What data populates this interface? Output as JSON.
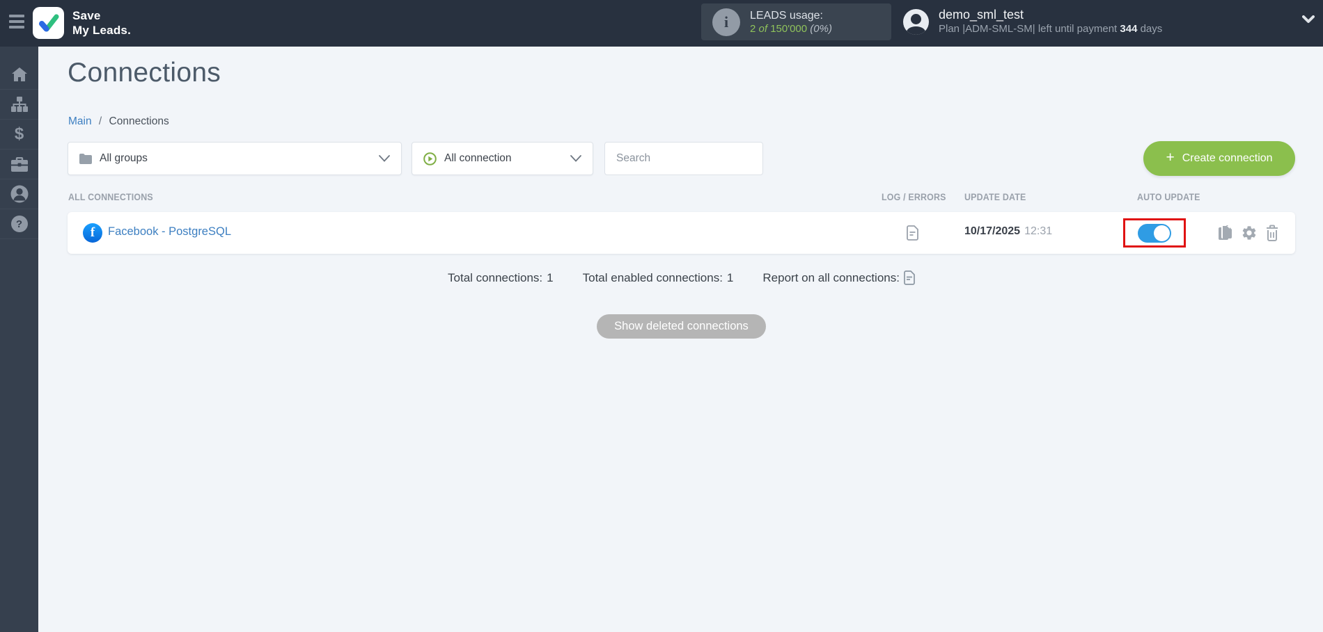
{
  "topbar": {
    "brand_line1": "Save",
    "brand_line2": "My Leads.",
    "leads_usage": {
      "label": "LEADS usage:",
      "used": "2",
      "of_word": "of",
      "total": "150'000",
      "percent": "(0%)"
    },
    "user": {
      "name": "demo_sml_test",
      "plan_prefix": "Plan |ADM-SML-SM| left until payment",
      "days_value": "344",
      "days_suffix": "days"
    }
  },
  "icons": {
    "info_glyph": "i",
    "facebook_glyph": "f",
    "dollar_glyph": "$",
    "question_glyph": "?"
  },
  "sidebar": {
    "items": [
      "home",
      "connections",
      "billing",
      "services",
      "account",
      "help"
    ]
  },
  "page": {
    "title": "Connections",
    "breadcrumb": {
      "root": "Main",
      "separator": "/",
      "current": "Connections"
    }
  },
  "filters": {
    "groups_dropdown": "All groups",
    "connection_dropdown": "All connection",
    "search_placeholder": "Search",
    "create_plus": "+",
    "create_button": "Create connection"
  },
  "table": {
    "headers": {
      "connections": "ALL CONNECTIONS",
      "log": "LOG / ERRORS",
      "update": "UPDATE DATE",
      "auto": "AUTO UPDATE"
    },
    "rows": [
      {
        "name": "Facebook - PostgreSQL",
        "date": "10/17/2025",
        "time": "12:31",
        "auto_update": "on"
      }
    ]
  },
  "summary": {
    "total_label": "Total connections:",
    "total_value": "1",
    "enabled_label": "Total enabled connections:",
    "enabled_value": "1",
    "report_label": "Report on all connections:"
  },
  "footer": {
    "show_deleted_button": "Show deleted connections"
  },
  "colors": {
    "topbar_bg": "#28313f",
    "sidebar_bg": "#36404e",
    "content_bg": "#f2f5f9",
    "accent_green": "#8bbf4d",
    "link_blue": "#3d7fc1",
    "toggle_blue": "#2f9ce4",
    "highlight_red": "#e01212",
    "usage_green": "#8fc25b"
  }
}
